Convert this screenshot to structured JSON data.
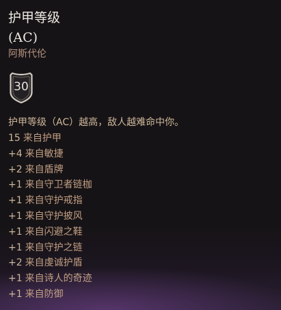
{
  "tooltip": {
    "title_line1": "护甲等级",
    "title_line2": " (AC)",
    "character_name": "阿斯代伦",
    "ac_value": "30",
    "badge_icon": "shield-icon",
    "description": "护甲等级（AC）越高，敌人越难命中你。",
    "breakdown": [
      {
        "amount": "15",
        "source": "来自护甲"
      },
      {
        "amount": "+4",
        "source": "来自敏捷"
      },
      {
        "amount": "+2",
        "source": "来自盾牌"
      },
      {
        "amount": "+1",
        "source": "来自守卫者链枷"
      },
      {
        "amount": "+1",
        "source": "来自守护戒指"
      },
      {
        "amount": "+1",
        "source": "来自守护披风"
      },
      {
        "amount": "+1",
        "source": "来自闪避之鞋"
      },
      {
        "amount": "+1",
        "source": "来自守护之链"
      },
      {
        "amount": "+2",
        "source": "来自虔诚护盾"
      },
      {
        "amount": "+1",
        "source": "来自诗人的奇迹"
      },
      {
        "amount": "+1",
        "source": "来自防御"
      }
    ]
  },
  "colors": {
    "background": "#161316",
    "title": "#ece8e2",
    "subtitle": "#b4937f",
    "text": "#cdb79a",
    "shield_border": "#d2ccc3",
    "glow": "#784696"
  }
}
